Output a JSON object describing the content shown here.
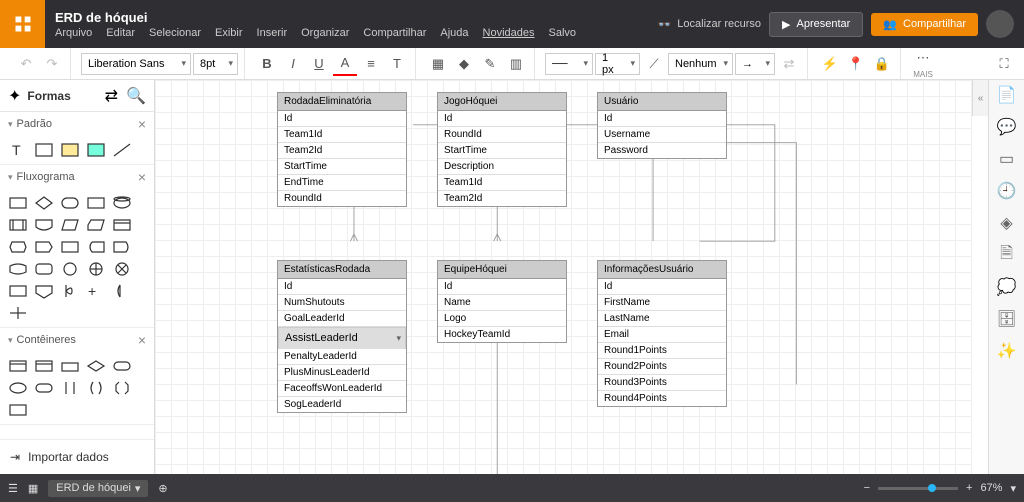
{
  "header": {
    "doc_title": "ERD de hóquei",
    "menu": [
      "Arquivo",
      "Editar",
      "Selecionar",
      "Exibir",
      "Inserir",
      "Organizar",
      "Compartilhar",
      "Ajuda",
      "Novidades",
      "Salvo"
    ],
    "locate": "Localizar recurso",
    "present": "Apresentar",
    "share": "Compartilhar"
  },
  "toolbar": {
    "font": "Liberation Sans",
    "font_size": "8pt",
    "line_width": "1 px",
    "line_style_none": "Nenhum",
    "more": "MAIS"
  },
  "panel": {
    "title": "Formas",
    "cat_default": "Padrão",
    "cat_flow": "Fluxograma",
    "cat_containers": "Contêineres",
    "import": "Importar dados"
  },
  "entities": {
    "e1": {
      "name": "RodadaEliminatória",
      "fields": [
        "Id",
        "Team1Id",
        "Team2Id",
        "StartTime",
        "EndTime",
        "RoundId"
      ]
    },
    "e2": {
      "name": "JogoHóquei",
      "fields": [
        "Id",
        "RoundId",
        "StartTime",
        "Description",
        "Team1Id",
        "Team2Id"
      ]
    },
    "e3": {
      "name": "Usuário",
      "fields": [
        "Id",
        "Username",
        "Password"
      ]
    },
    "e4": {
      "name": "EstatísticasRodada",
      "fields": [
        "Id",
        "NumShutouts",
        "GoalLeaderId",
        "AssistLeaderId",
        "PenaltyLeaderId",
        "PlusMinusLeaderId",
        "FaceoffsWonLeaderId",
        "SogLeaderId"
      ],
      "selected": "AssistLeaderId"
    },
    "e5": {
      "name": "EquipeHóquei",
      "fields": [
        "Id",
        "Name",
        "Logo",
        "HockeyTeamId"
      ]
    },
    "e6": {
      "name": "InformaçõesUsuário",
      "fields": [
        "Id",
        "FirstName",
        "LastName",
        "Email",
        "Round1Points",
        "Round2Points",
        "Round3Points",
        "Round4Points"
      ]
    }
  },
  "bottom": {
    "tab": "ERD de hóquei",
    "zoom": "67%"
  }
}
